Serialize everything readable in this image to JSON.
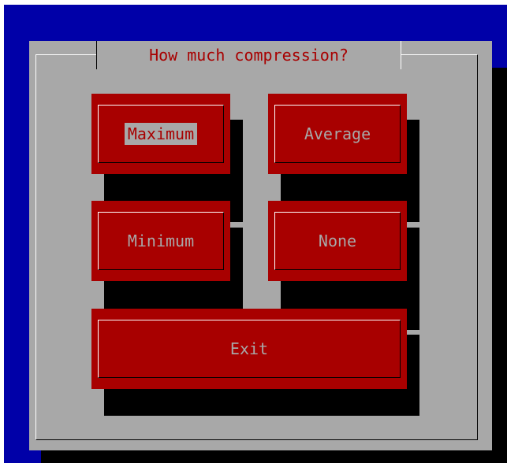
{
  "dialog": {
    "title": "How much compression?",
    "buttons": [
      {
        "id": "maximum",
        "label": "Maximum",
        "focused": true
      },
      {
        "id": "average",
        "label": "Average",
        "focused": false
      },
      {
        "id": "minimum",
        "label": "Minimum",
        "focused": false
      },
      {
        "id": "none",
        "label": "None",
        "focused": false
      },
      {
        "id": "exit",
        "label": "Exit",
        "focused": false
      }
    ]
  },
  "colors": {
    "screen_background": "#0000a8",
    "dialog_background": "#a8a8a8",
    "button_background": "#a80000",
    "title_text": "#a80000",
    "shadow": "#000000"
  }
}
